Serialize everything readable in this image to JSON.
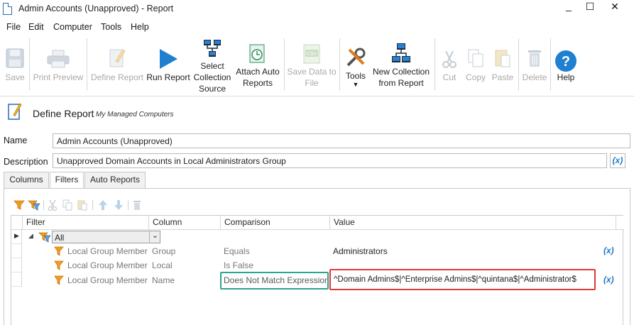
{
  "window": {
    "title": "Admin Accounts (Unapproved) - Report",
    "minimize_glyph": "_",
    "maximize_glyph": "☐",
    "close_glyph": "✕"
  },
  "menu": [
    "File",
    "Edit",
    "Computer",
    "Tools",
    "Help"
  ],
  "toolbar": {
    "save": "Save",
    "print_preview": "Print Preview",
    "define_report": "Define Report",
    "run_report": "Run Report",
    "select_collection_source": [
      "Select",
      "Collection",
      "Source"
    ],
    "attach_auto_reports": [
      "Attach Auto",
      "Reports"
    ],
    "save_data_to_file": [
      "Save Data to",
      "File"
    ],
    "tools": "Tools",
    "new_collection_from_report": [
      "New Collection",
      "from Report"
    ],
    "cut": "Cut",
    "copy": "Copy",
    "paste": "Paste",
    "delete": "Delete",
    "help": "Help",
    "csv_badge": "CSV"
  },
  "define_report": {
    "title": "Define Report",
    "subtitle": "My Managed Computers"
  },
  "form": {
    "name_label": "Name",
    "name_value": "Admin Accounts (Unapproved)",
    "description_label": "Description",
    "description_value": "Unapproved Domain Accounts in Local Administrators Group",
    "variable_button": "(x)"
  },
  "tabs": [
    {
      "label": "Columns",
      "active": false
    },
    {
      "label": "Filters",
      "active": true
    },
    {
      "label": "Auto Reports",
      "active": false
    }
  ],
  "grid": {
    "headers": [
      "Filter",
      "Column",
      "Comparison",
      "Value"
    ],
    "group": {
      "label": "All",
      "dropdown": "⌄"
    },
    "rows": [
      {
        "filter": "Local Group Member",
        "column": "Group",
        "comparison": "Equals",
        "value": "Administrators",
        "var": "(x)"
      },
      {
        "filter": "Local Group Member",
        "column": "Local",
        "comparison": "Is False",
        "value": "",
        "var": ""
      },
      {
        "filter": "Local Group Member",
        "column": "Name",
        "comparison": "Does Not Match Expression",
        "value": "^Domain Admins$|^Enterprise Admins$|^quintana$|^Administrator$",
        "var": "(x)"
      }
    ]
  },
  "colors": {
    "accent_blue": "#1f78c8",
    "highlight_green": "#2aa58e",
    "highlight_red": "#e0383b",
    "filter_orange": "#f39a1e"
  }
}
